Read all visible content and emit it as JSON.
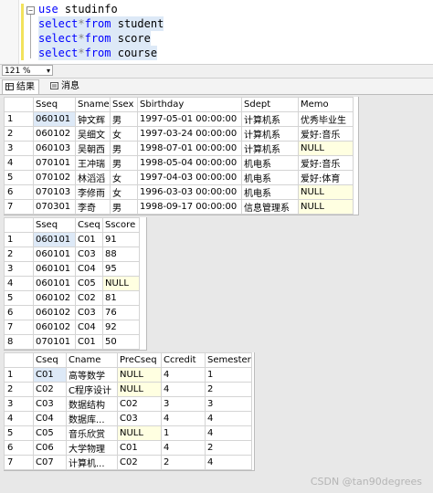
{
  "editor": {
    "lines": [
      {
        "kw": "use",
        "rest": " studinfo"
      },
      {
        "kw": "select",
        "op": "*",
        "kw2": "from",
        "rest": " student"
      },
      {
        "kw": "select",
        "op": "*",
        "kw2": "from",
        "rest": " score"
      },
      {
        "kw": "select",
        "op": "*",
        "kw2": "from",
        "rest": " course"
      }
    ]
  },
  "zoom": "121 %",
  "tabs": {
    "results": "结果",
    "messages": "消息"
  },
  "grids": [
    {
      "columns": [
        "",
        "Sseq",
        "Sname",
        "Ssex",
        "Sbirthday",
        "Sdept",
        "Memo"
      ],
      "rows": [
        [
          "1",
          "060101",
          "钟文辉",
          "男",
          "1997-05-01 00:00:00",
          "计算机系",
          "优秀毕业生"
        ],
        [
          "2",
          "060102",
          "吴细文",
          "女",
          "1997-03-24 00:00:00",
          "计算机系",
          "爱好:音乐"
        ],
        [
          "3",
          "060103",
          "吴朝西",
          "男",
          "1998-07-01 00:00:00",
          "计算机系",
          "NULL"
        ],
        [
          "4",
          "070101",
          "王冲瑞",
          "男",
          "1998-05-04 00:00:00",
          "机电系",
          "爱好:音乐"
        ],
        [
          "5",
          "070102",
          "林滔滔",
          "女",
          "1997-04-03 00:00:00",
          "机电系",
          "爱好:体育"
        ],
        [
          "6",
          "070103",
          "李修雨",
          "女",
          "1996-03-03 00:00:00",
          "机电系",
          "NULL"
        ],
        [
          "7",
          "070301",
          "李奇",
          "男",
          "1998-09-17 00:00:00",
          "信息管理系",
          "NULL"
        ]
      ]
    },
    {
      "columns": [
        "",
        "Sseq",
        "Cseq",
        "Sscore"
      ],
      "rows": [
        [
          "1",
          "060101",
          "C01",
          "91"
        ],
        [
          "2",
          "060101",
          "C03",
          "88"
        ],
        [
          "3",
          "060101",
          "C04",
          "95"
        ],
        [
          "4",
          "060101",
          "C05",
          "NULL"
        ],
        [
          "5",
          "060102",
          "C02",
          "81"
        ],
        [
          "6",
          "060102",
          "C03",
          "76"
        ],
        [
          "7",
          "060102",
          "C04",
          "92"
        ],
        [
          "8",
          "070101",
          "C01",
          "50"
        ]
      ]
    },
    {
      "columns": [
        "",
        "Cseq",
        "Cname",
        "PreCseq",
        "Ccredit",
        "Semester"
      ],
      "rows": [
        [
          "1",
          "C01",
          "高等数学",
          "NULL",
          "4",
          "1"
        ],
        [
          "2",
          "C02",
          "C程序设计",
          "NULL",
          "4",
          "2"
        ],
        [
          "3",
          "C03",
          "数据结构",
          "C02",
          "3",
          "3"
        ],
        [
          "4",
          "C04",
          "数据库...",
          "C03",
          "4",
          "4"
        ],
        [
          "5",
          "C05",
          "音乐欣赏",
          "NULL",
          "1",
          "4"
        ],
        [
          "6",
          "C06",
          "大学物理",
          "C01",
          "4",
          "2"
        ],
        [
          "7",
          "C07",
          "计算机...",
          "C02",
          "2",
          "4"
        ]
      ]
    }
  ],
  "watermark": "CSDN @tan90degrees"
}
